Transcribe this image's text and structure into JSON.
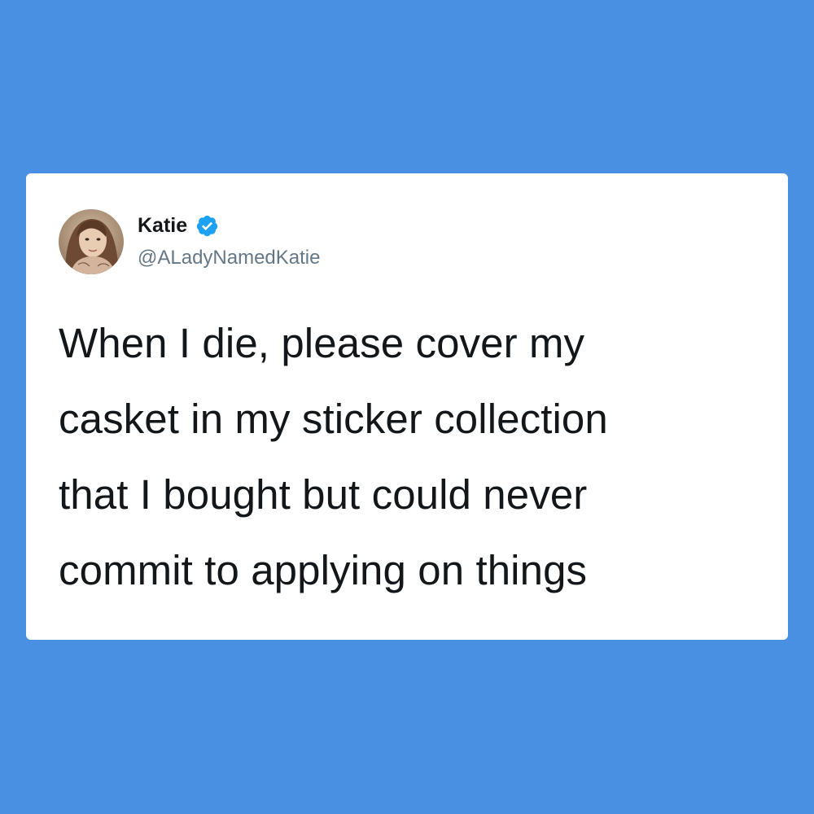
{
  "page": {
    "background_color": "#4a90e2"
  },
  "tweet": {
    "avatar_icon": "profile-photo",
    "display_name": "Katie",
    "verified_icon": "verified-badge-icon",
    "verified_color": "#1da1f2",
    "handle": "@ALadyNamedKatie",
    "text_lines": [
      "When I die, please cover my",
      "casket in my sticker collection",
      "that I bought but could never",
      "commit to applying on things"
    ],
    "text_color": "#14171a",
    "handle_color": "#657786"
  }
}
